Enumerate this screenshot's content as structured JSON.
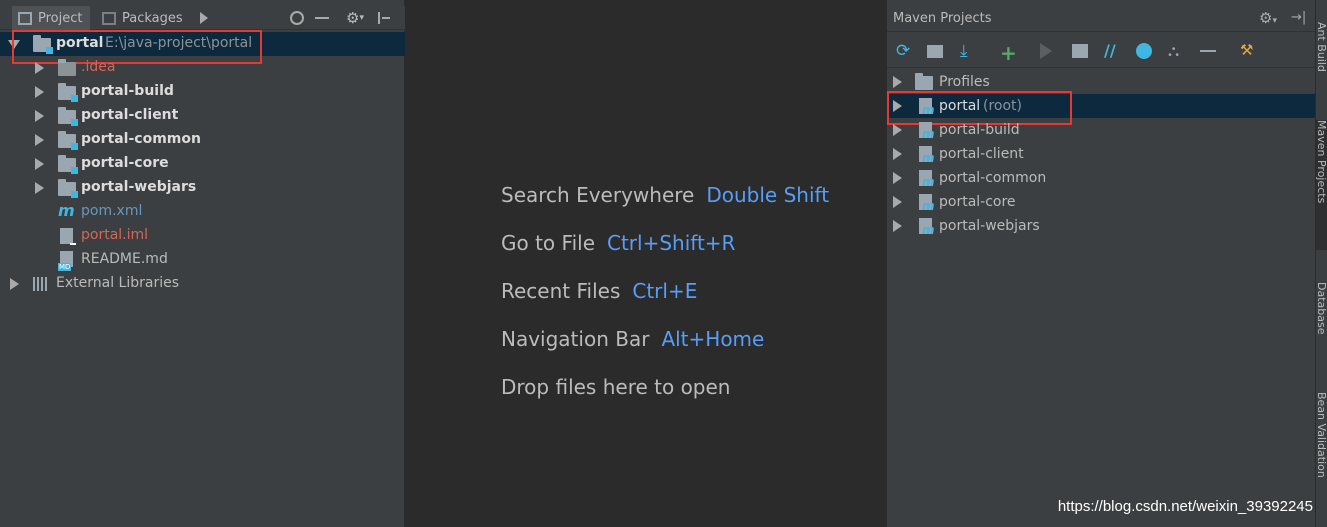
{
  "left_panel": {
    "tabs": [
      {
        "label": "Project",
        "icon": "project-icon"
      },
      {
        "label": "Packages",
        "icon": "packages-icon"
      }
    ],
    "tree": {
      "root": {
        "name": "portal",
        "path": "E:\\java-project\\portal"
      },
      "children": [
        {
          "name": ".idea",
          "type": "folder",
          "color": "#d1675a"
        },
        {
          "name": "portal-build",
          "type": "module"
        },
        {
          "name": "portal-client",
          "type": "module"
        },
        {
          "name": "portal-common",
          "type": "module"
        },
        {
          "name": "portal-core",
          "type": "module"
        },
        {
          "name": "portal-webjars",
          "type": "module"
        },
        {
          "name": "pom.xml",
          "type": "maven-file",
          "color": "#6897bb"
        },
        {
          "name": "portal.iml",
          "type": "iml-file",
          "color": "#d1675a"
        },
        {
          "name": "README.md",
          "type": "md-file"
        }
      ],
      "external": "External Libraries"
    }
  },
  "center": {
    "hints": [
      {
        "text": "Search Everywhere",
        "key": "Double Shift"
      },
      {
        "text": "Go to File",
        "key": "Ctrl+Shift+R"
      },
      {
        "text": "Recent Files",
        "key": "Ctrl+E"
      },
      {
        "text": "Navigation Bar",
        "key": "Alt+Home"
      },
      {
        "text": "Drop files here to open",
        "key": ""
      }
    ]
  },
  "right_panel": {
    "title": "Maven Projects",
    "items": [
      {
        "name": "Profiles",
        "suffix": ""
      },
      {
        "name": "portal",
        "suffix": "(root)"
      },
      {
        "name": "portal-build",
        "suffix": ""
      },
      {
        "name": "portal-client",
        "suffix": ""
      },
      {
        "name": "portal-common",
        "suffix": ""
      },
      {
        "name": "portal-core",
        "suffix": ""
      },
      {
        "name": "portal-webjars",
        "suffix": ""
      }
    ]
  },
  "side_strip": {
    "tabs": [
      "Ant Build",
      "Maven Projects",
      "Database",
      "Bean Validation"
    ]
  },
  "watermark": "https://blog.csdn.net/weixin_39392245",
  "colors": {
    "accent": "#589df6",
    "selection": "#0d293e",
    "highlight_box": "#e53935"
  }
}
